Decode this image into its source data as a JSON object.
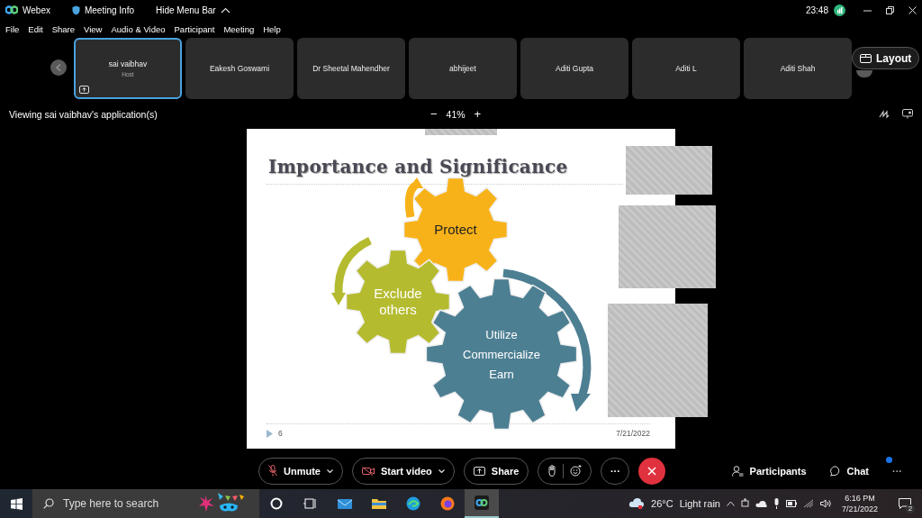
{
  "title_bar": {
    "app_name": "Webex",
    "meeting_info": "Meeting Info",
    "hide_menu": "Hide Menu Bar",
    "time": "23:48"
  },
  "menu": [
    "File",
    "Edit",
    "Share",
    "View",
    "Audio & Video",
    "Participant",
    "Meeting",
    "Help"
  ],
  "participants": [
    {
      "name": "sai vaibhav",
      "role": "Host",
      "selected": true
    },
    {
      "name": "Eakesh Goswami",
      "selected": false
    },
    {
      "name": "Dr Sheetal Mahendher",
      "selected": false
    },
    {
      "name": "abhijeet",
      "selected": false
    },
    {
      "name": "Aditi Gupta",
      "selected": false
    },
    {
      "name": "Aditi L",
      "selected": false
    },
    {
      "name": "Aditi Shah",
      "selected": false
    }
  ],
  "layout_button": "Layout",
  "view_bar": {
    "label": "Viewing sai vaibhav's application(s)",
    "zoom_out": "−",
    "zoom": "41%",
    "zoom_in": "+"
  },
  "slide": {
    "title": "Importance and Significance",
    "gears": [
      {
        "lines": [
          "Protect"
        ],
        "color": "#f8b219"
      },
      {
        "lines": [
          "Exclude",
          "others"
        ],
        "color": "#b5bb2f"
      },
      {
        "lines": [
          "Utilize",
          "Commercialize",
          "Earn"
        ],
        "color": "#4d7f93"
      }
    ],
    "page": "6",
    "date": "7/21/2022"
  },
  "controls": [
    {
      "kind": "mute",
      "label": "Unmute"
    },
    {
      "kind": "video",
      "label": "Start video"
    },
    {
      "kind": "share",
      "label": "Share"
    },
    {
      "kind": "reactions"
    },
    {
      "kind": "more",
      "label": "···"
    },
    {
      "kind": "end"
    }
  ],
  "side_controls": [
    {
      "kind": "participants",
      "label": "Participants"
    },
    {
      "kind": "chat",
      "label": "Chat",
      "unread": true
    },
    {
      "kind": "more",
      "label": "···"
    }
  ],
  "taskbar": {
    "search_placeholder": "Type here to search",
    "temperature": "26°C",
    "weather": "Light rain",
    "time": "6:16 PM",
    "date": "7/21/2022",
    "notifications": "2"
  }
}
